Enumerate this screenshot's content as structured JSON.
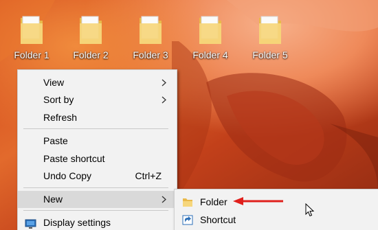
{
  "desktop": {
    "icons": [
      {
        "label": "Folder 1",
        "icon": "folder-icon"
      },
      {
        "label": "Folder 2",
        "icon": "folder-icon"
      },
      {
        "label": "Folder 3",
        "icon": "folder-icon"
      },
      {
        "label": "Folder 4",
        "icon": "folder-icon"
      },
      {
        "label": "Folder 5",
        "icon": "folder-icon"
      }
    ]
  },
  "context_menu": {
    "items": [
      {
        "label": "View",
        "has_submenu": true
      },
      {
        "label": "Sort by",
        "has_submenu": true
      },
      {
        "label": "Refresh",
        "has_submenu": false
      },
      {
        "label": "Paste",
        "has_submenu": false
      },
      {
        "label": "Paste shortcut",
        "has_submenu": false
      },
      {
        "label": "Undo Copy",
        "shortcut": "Ctrl+Z",
        "has_submenu": false
      },
      {
        "label": "New",
        "has_submenu": true,
        "highlighted": true
      },
      {
        "label": "Display settings",
        "icon": "display-icon",
        "has_submenu": false
      }
    ]
  },
  "new_submenu": {
    "items": [
      {
        "label": "Folder",
        "icon": "folder-icon"
      },
      {
        "label": "Shortcut",
        "icon": "shortcut-icon"
      }
    ]
  },
  "colors": {
    "menu_background": "#f2f2f2",
    "highlight": "#d9d9d9",
    "annotation_arrow": "#e0201c",
    "folder_yellow": "#f6d67c"
  }
}
